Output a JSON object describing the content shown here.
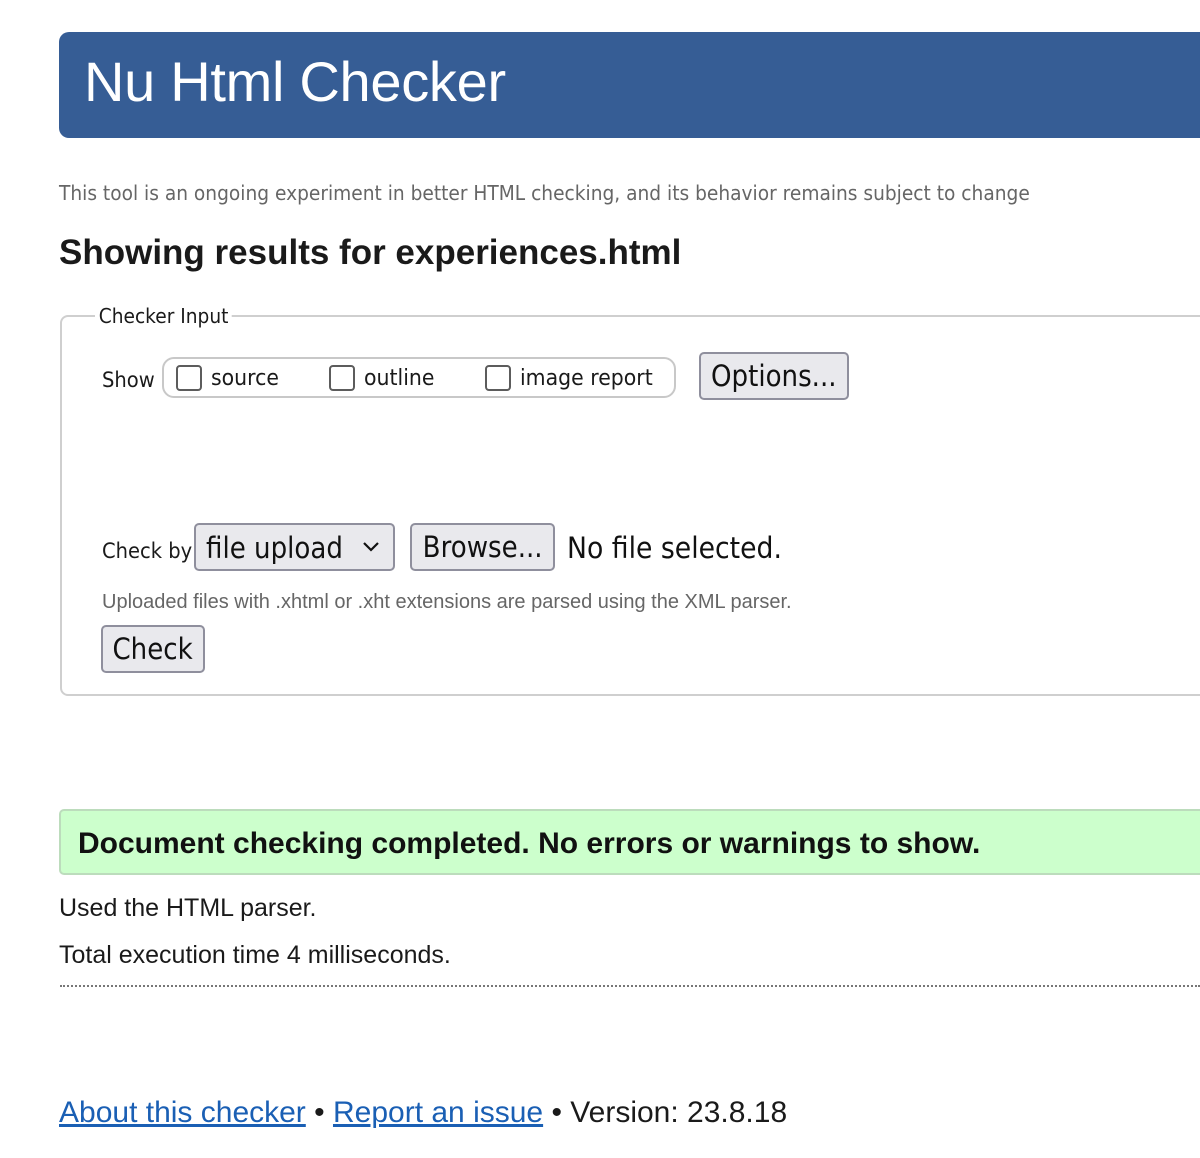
{
  "header": {
    "title": "Nu Html Checker"
  },
  "disclaimer": "This tool is an ongoing experiment in better HTML checking, and its behavior remains subject to change",
  "results_heading": "Showing results for experiences.html",
  "checker_input": {
    "legend": "Checker Input",
    "show_label": "Show",
    "show_options": [
      {
        "label": "source",
        "checked": false
      },
      {
        "label": "outline",
        "checked": false
      },
      {
        "label": "image report",
        "checked": false
      }
    ],
    "options_button": "Options...",
    "check_by_label": "Check by",
    "check_by_selected": "file upload",
    "browse_button": "Browse...",
    "file_status": "No file selected.",
    "upload_note": "Uploaded files with .xhtml or .xht extensions are parsed using the XML parser.",
    "check_button": "Check"
  },
  "result": {
    "success_message": "Document checking completed. No errors or warnings to show.",
    "parser_note": "Used the HTML parser.",
    "time_note": "Total execution time 4 milliseconds."
  },
  "footer": {
    "about_link": "About this checker",
    "separator_1": " • ",
    "report_link": "Report an issue",
    "separator_2": " • ",
    "version_text": "Version: 23.8.18"
  },
  "colors": {
    "header_bg": "#365d95",
    "success_bg": "#ccffcc",
    "link": "#1a5fb4"
  }
}
